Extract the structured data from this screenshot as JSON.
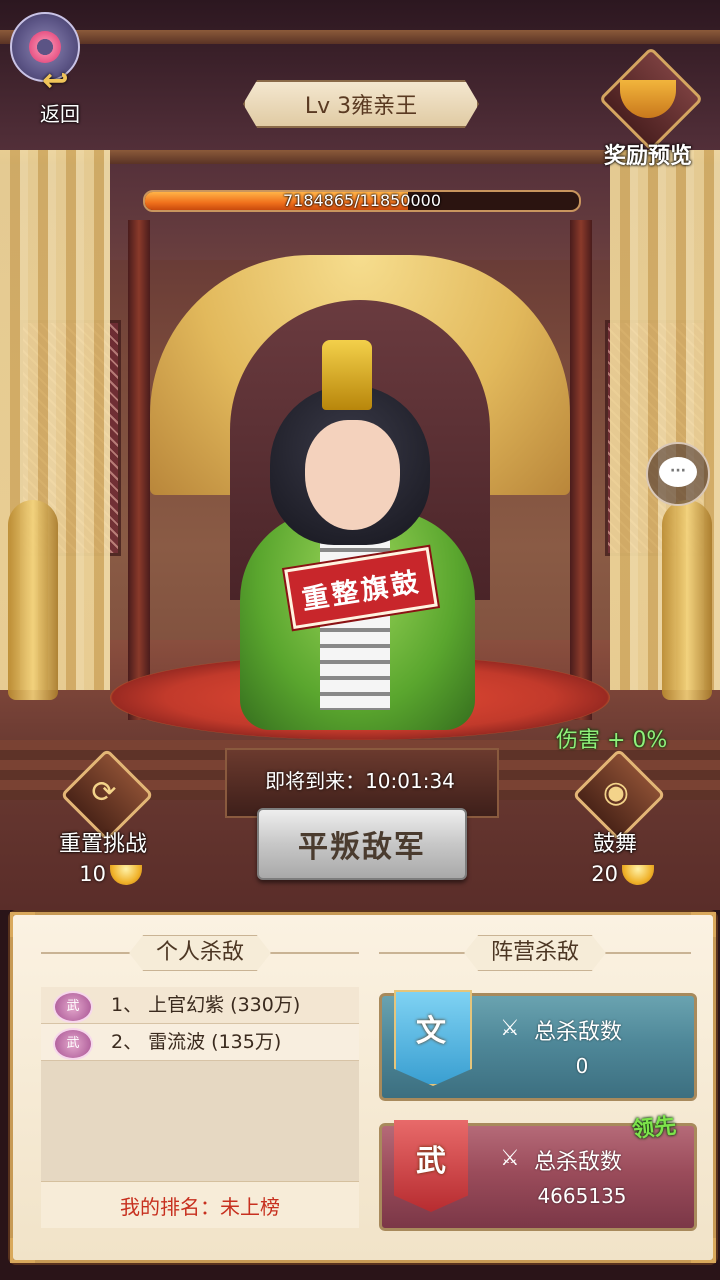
{
  "nav": {
    "back_label": "返回"
  },
  "boss": {
    "level_title": "Lv 3雍亲王",
    "hp_text": "7184865/11850000",
    "hp_fraction": 0.6063,
    "banner_text": "重整旗鼓"
  },
  "reward": {
    "label": "奖励预览"
  },
  "battle": {
    "damage_bonus": "伤害 + 0%",
    "countdown_label": "即将到来：10:01:34",
    "reset": {
      "label": "重置挑战",
      "cost": "10"
    },
    "cheer": {
      "label": "鼓舞",
      "cost": "20"
    },
    "main_action": "平叛敌军"
  },
  "personal": {
    "title": "个人杀敌",
    "rows": [
      {
        "badge": "武",
        "text": "1、 上官幻紫 (330万)"
      },
      {
        "badge": "武",
        "text": "2、 雷流波 (135万)"
      }
    ],
    "my_rank": "我的排名：未上榜"
  },
  "camp": {
    "title": "阵营杀敌",
    "wen": {
      "flag": "文",
      "label": "总杀敌数",
      "value": "0"
    },
    "wu": {
      "flag": "武",
      "label": "总杀敌数",
      "value": "4665135"
    },
    "lead_label": "领先"
  },
  "colors": {
    "hp_fill": "#f0701c",
    "damage_text": "#8ff07a",
    "rank_text": "#c7301f",
    "wen_panel": "#4f8899",
    "wu_panel": "#9b4c5b"
  }
}
